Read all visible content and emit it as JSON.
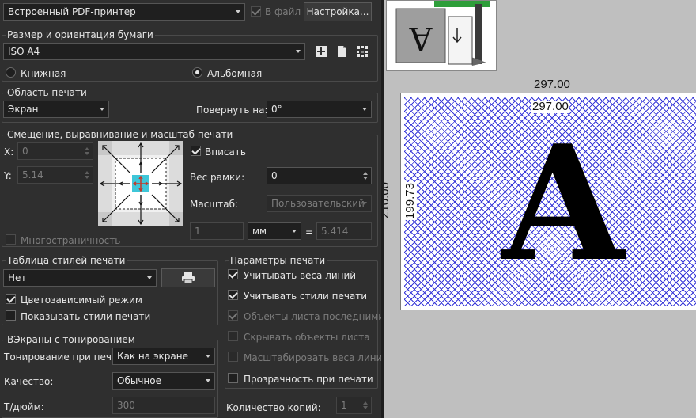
{
  "printer": {
    "name": "Встроенный PDF-принтер",
    "to_file_label": "В файл",
    "to_file_checked": true,
    "settings_label": "Настройка..."
  },
  "paper": {
    "group_title": "Размер и ориентация бумаги",
    "size": "ISO A4",
    "orientation_portrait": "Книжная",
    "orientation_landscape": "Альбомная",
    "selected": "landscape",
    "icons": [
      "add-icon",
      "document-icon",
      "grid-icon"
    ]
  },
  "area": {
    "group_title": "Область печати",
    "value": "Экран",
    "rotate_label": "Повернуть на:",
    "rotate_value": "0°"
  },
  "offset": {
    "group_title": "Смещение, выравнивание и масштаб печати",
    "x_label": "X:",
    "x_value": "0",
    "y_label": "Y:",
    "y_value": "5.14",
    "fit_label": "Вписать",
    "fit_checked": true,
    "frame_label": "Вес рамки:",
    "frame_value": "0",
    "scale_label": "Масштаб:",
    "scale_value": "Пользовательский",
    "scale_num": "1",
    "unit": "мм",
    "equals": "=",
    "scale_result": "5.414",
    "multipage_label": "Многостраничность",
    "multipage_checked": false
  },
  "styles": {
    "group_title": "Таблица стилей печати",
    "value": "Нет",
    "color_mode_label": "Цветозависимый режим",
    "color_mode_checked": true,
    "show_styles_label": "Показывать стили печати",
    "show_styles_checked": false
  },
  "params": {
    "group_title": "Параметры печати",
    "items": [
      {
        "label": "Учитывать веса линий",
        "checked": true,
        "enabled": true
      },
      {
        "label": "Учитывать стили печати",
        "checked": true,
        "enabled": true
      },
      {
        "label": "Объекты листа последними",
        "checked": true,
        "enabled": false
      },
      {
        "label": "Скрывать объекты листа",
        "checked": false,
        "enabled": false
      },
      {
        "label": "Масштабировать веса линий",
        "checked": false,
        "enabled": false
      },
      {
        "label": "Прозрачность при печати",
        "checked": false,
        "enabled": true
      }
    ],
    "copies_label": "Количество копий:",
    "copies_value": "1"
  },
  "shaded": {
    "group_title": "ВЭкраны с тонированием",
    "shade_label": "Тонирование при печат",
    "shade_value": "Как на экране",
    "quality_label": "Качество:",
    "quality_value": "Обычное",
    "dpi_label": "Т/дюйм:",
    "dpi_value": "300"
  },
  "preview": {
    "width_label": "297.00",
    "inner_width_label": "297.00",
    "height_label": "210.00",
    "inner_height_label": "199.73",
    "big_letter": "A",
    "thumb_letter": "A",
    "colors": {
      "hatch": "#3838d8",
      "background": "#bfbfbf"
    }
  }
}
